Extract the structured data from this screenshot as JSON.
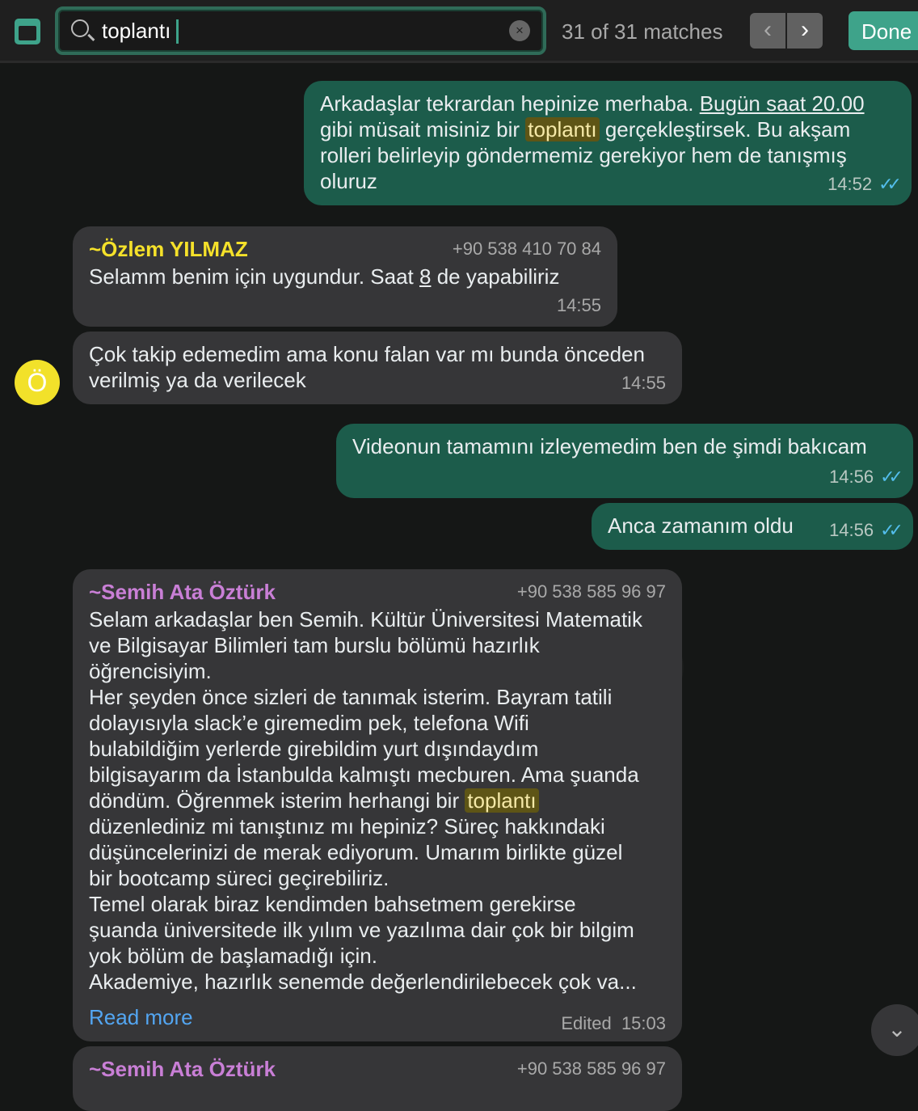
{
  "search": {
    "query": "toplantı",
    "matches": "31 of 31 matches",
    "done": "Done",
    "clear": "×",
    "prev": "‹",
    "next": "›"
  },
  "messages": {
    "m1": {
      "lines": [
        [
          {
            "t": "Arkadaşlar tekrardan hepinize merhaba. "
          },
          {
            "t": "Bugün saat 20.00",
            "u": true
          }
        ],
        [
          {
            "t": "gibi müsait misiniz bir "
          },
          {
            "t": "toplantı",
            "hl": true
          },
          {
            "t": " gerçekleştirsek. Bu akşam"
          }
        ],
        [
          {
            "t": "rolleri belirleyip göndermemiz gerekiyor hem de tanışmış"
          }
        ],
        [
          {
            "t": "oluruz"
          }
        ]
      ],
      "time": "14:52"
    },
    "m2": {
      "sender": "~Özlem YILMAZ",
      "phone": "+90 538 410 70 84",
      "lines": [
        [
          {
            "t": "Selamm benim için uygundur. Saat "
          },
          {
            "t": "8",
            "u": true
          },
          {
            "t": " de yapabiliriz"
          }
        ]
      ],
      "time": "14:55"
    },
    "m3": {
      "lines": [
        [
          {
            "t": "Çok takip edemedim ama konu falan var mı bunda önceden"
          }
        ],
        [
          {
            "t": "verilmiş ya da verilecek"
          }
        ]
      ],
      "time": "14:55",
      "avatar": "Ö"
    },
    "m4": {
      "lines": [
        [
          {
            "t": "Videonun tamamını izleyemedim ben de şimdi bakıcam"
          }
        ]
      ],
      "time": "14:56"
    },
    "m5": {
      "lines": [
        [
          {
            "t": "Anca zamanım oldu"
          }
        ]
      ],
      "time": "14:56"
    },
    "m6": {
      "sender": "~Semih Ata Öztürk",
      "phone": "+90 538 585 96 97",
      "lines": [
        [
          {
            "t": "Selam arkadaşlar ben Semih. Kültür Üniversitesi Matematik"
          }
        ],
        [
          {
            "t": "ve Bilgisayar Bilimleri tam burslu bölümü hazırlık"
          }
        ],
        [
          {
            "t": "öğrencisiyim."
          }
        ],
        [
          {
            "t": "Her şeyden önce sizleri de tanımak isterim. Bayram tatili"
          }
        ],
        [
          {
            "t": "dolayısıyla slack’e giremedim pek, telefona Wifi"
          }
        ],
        [
          {
            "t": "bulabildiğim yerlerde girebildim yurt dışındaydım"
          }
        ],
        [
          {
            "t": "bilgisayarım da İstanbulda kalmıştı mecburen. Ama şuanda"
          }
        ],
        [
          {
            "t": "döndüm. Öğrenmek isterim herhangi bir "
          },
          {
            "t": "toplantı",
            "hl": true
          }
        ],
        [
          {
            "t": "düzenlediniz mi tanıştınız mı hepiniz? Süreç hakkındaki"
          }
        ],
        [
          {
            "t": "düşüncelerinizi de merak ediyorum. Umarım birlikte güzel"
          }
        ],
        [
          {
            "t": "bir bootcamp süreci geçirebiliriz."
          }
        ],
        [
          {
            "t": "Temel olarak biraz kendimden bahsetmem gerekirse"
          }
        ],
        [
          {
            "t": "şuanda üniversitede ilk yılım ve yazılıma dair çok bir bilgim"
          }
        ],
        [
          {
            "t": "yok bölüm de başlamadığı için."
          }
        ],
        [
          {
            "t": "Akademiye, hazırlık senemde değerlendirilebecek çok va..."
          }
        ]
      ],
      "read_more": "Read more",
      "edited": "Edited",
      "time": "15:03"
    },
    "m7": {
      "sender": "~Semih Ata Öztürk",
      "phone": "+90 538 585 96 97"
    }
  },
  "colors": {
    "outgoing": "#1c5c4b",
    "incoming": "#363638",
    "accent": "#3ea38a",
    "highlight": "#5e5516",
    "sender1": "#f5e12a",
    "sender2": "#c97fd6",
    "link": "#53a6f2"
  }
}
